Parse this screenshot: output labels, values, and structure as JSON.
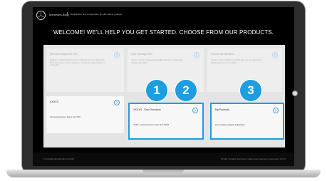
{
  "colors": {
    "accent": "#1e9de0",
    "screen_bg": "#000000",
    "content_bg": "#e4e4e4",
    "card_bg": "#f7f7f7"
  },
  "header": {
    "brand": "Mercedes-Benz",
    "subtitle": "Registration and configuration for aftermarket products",
    "logo_icon": "mercedes-star-icon"
  },
  "welcome": "WELCOME! WE'LL HELP YOU GET STARTED. CHOOSE FROM OUR PRODUCTS.",
  "cards_top": [
    {
      "title": "Standard Diagnosis Xxx",
      "desc": "Request of Standard Diagnosis Xxx? Manage here your Mercedes-Benz XXX partner and it is possible to request the authorisation in a simple way.",
      "icon": "chevron-right-icon"
    },
    {
      "title": "User management",
      "desc": "Get an overview of all users associated with your company and manage their rights.",
      "icon": "chevron-right-icon"
    },
    {
      "title": "Vehicle Identification",
      "desc": "Would you like to identify a vehicle? Here you can request the authorisation and use it quickly.",
      "icon": "chevron-right-icon"
    }
  ],
  "cards_bottom": [
    {
      "title": "XXXXX",
      "sub": "Xxxxxxxxxxxxxxxx Xxxxx Xxx XXX",
      "icon": "chevron-right-icon"
    },
    {
      "title": "XXXXX - Xxxx Xxxxxxxx",
      "sub": "XXXX - Xxxx Xxxxxxxx Xxxxx Xxx XXXX",
      "icon": "chevron-right-icon"
    },
    {
      "title": "My Products",
      "sub": "List of active products subscribed",
      "icon": "chevron-right-icon"
    }
  ],
  "badges": [
    "1",
    "2",
    "3"
  ],
  "footer": {
    "copyright": "© Copyright Mercedes-Benz AG 2021",
    "links": "Provider | Cookies | Documents | Data privacy statement | Legal notice | 1.0.0.0"
  }
}
